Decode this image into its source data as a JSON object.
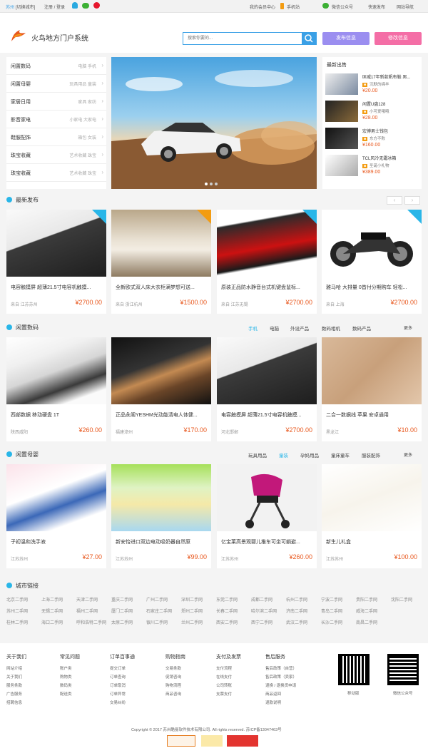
{
  "topbar": {
    "city": "苏州",
    "switch_city": "[切换城市]",
    "login": "注册 / 登录",
    "member": "我的会员中心",
    "mobile": "手机站",
    "wechat": "微信公众号",
    "quick_post": "快速发布",
    "site_nav": "网站导航"
  },
  "header": {
    "logo": "火鸟地方门户系统",
    "search_placeholder": "搜索你要的...",
    "post_btn": "发布信息",
    "edit_btn": "修改信息"
  },
  "colors": {
    "accent": "#29b6e8",
    "price": "#e8581e",
    "post": "#9b8ef0",
    "edit": "#f46ea6"
  },
  "categories": [
    {
      "name": "闲置数码",
      "sub": "电脑  手机"
    },
    {
      "name": "闲置母婴",
      "sub": "玩具用品  童装"
    },
    {
      "name": "家居日用",
      "sub": "家具  家纺"
    },
    {
      "name": "影音家电",
      "sub": "小家电  大家电"
    },
    {
      "name": "鞋服配饰",
      "sub": "箱包  女装"
    },
    {
      "name": "珠宝收藏",
      "sub": "艺术收藏  珠宝"
    },
    {
      "name": "珠宝收藏",
      "sub": "艺术收藏  珠宝"
    }
  ],
  "hot": {
    "title": "最新出售",
    "items": [
      {
        "title": "匡威17年新款帆布鞋 男...",
        "user": "沉默的绵羊",
        "price": "¥20.00"
      },
      {
        "title": "闲置U盘128",
        "user": "小可爱哦哦",
        "price": "¥28.00"
      },
      {
        "title": "宏博男士钱包",
        "user": "东方不败",
        "price": "¥160.00"
      },
      {
        "title": "TCL风冷无霜冰箱",
        "user": "圣诞小礼物",
        "price": "¥389.00"
      }
    ]
  },
  "latest": {
    "title": "最新发布",
    "items": [
      {
        "title": "电容触摸屏 超薄21.5寸电容机触摸...",
        "loc": "来自  江苏苏州",
        "price": "¥2700.00"
      },
      {
        "title": "全新欧式双人床大衣柜满梦想可送...",
        "loc": "来自  浙江杭州",
        "price": "¥1500.00"
      },
      {
        "title": "原装正品防水静音台式机键盘鼠标...",
        "loc": "来自  江苏无锡",
        "price": "¥2700.00"
      },
      {
        "title": "雅马哈 大排量 0首付分期购车 轻松...",
        "loc": "来自  上海",
        "price": "¥2700.00"
      }
    ]
  },
  "digital": {
    "title": "闲置数码",
    "tabs": [
      "手机",
      "电脑",
      "外设产品",
      "数码相机",
      "数码产品"
    ],
    "more": "更多",
    "items": [
      {
        "title": "西部数据  移动硬盘 1T",
        "loc": "陕西咸阳",
        "price": "¥260.00"
      },
      {
        "title": "正品永阁YESHM光动能清电人体健...",
        "loc": "福建漳州",
        "price": "¥170.00"
      },
      {
        "title": "电容触摸屏 超薄21.5寸电容机触摸...",
        "loc": "河北邯郸",
        "price": "¥2700.00"
      },
      {
        "title": "二合一数据线 苹果 安卓通用",
        "loc": "黑龙江",
        "price": "¥10.00"
      }
    ]
  },
  "baby": {
    "title": "闲置母婴",
    "tabs": [
      "玩具用品",
      "童装",
      "孕妈用品",
      "童床童车",
      "服装配饰"
    ],
    "more": "更多",
    "items": [
      {
        "title": "子初温和洗手液",
        "loc": "江苏苏州",
        "price": "¥27.00"
      },
      {
        "title": "新安怡进口双边电动吸奶器自然原",
        "loc": "江苏苏州",
        "price": "¥99.00"
      },
      {
        "title": "亿宝莱高景观婴儿推车可坐可躺避...",
        "loc": "江苏苏州",
        "price": "¥260.00"
      },
      {
        "title": "新生儿礼盒",
        "loc": "江苏苏州",
        "price": "¥100.00"
      }
    ]
  },
  "links": {
    "title": "城市链接",
    "rows": [
      [
        "北京二手网",
        "上海二手网",
        "天津二手网",
        "重庆二手网",
        "广州二手网",
        "深圳二手网",
        "东莞二手网",
        "成都二手网",
        "杭州二手网",
        "宁波二手网",
        "贵阳二手网",
        "沈阳二手网"
      ],
      [
        "苏州二手网",
        "无锡二手网",
        "福州二手网",
        "厦门二手网",
        "石家庄二手网",
        "郑州二手网",
        "长春二手网",
        "哈尔滨二手网",
        "济南二手网",
        "青岛二手网",
        "威海二手网"
      ],
      [
        "桂林二手网",
        "海口二手网",
        "呼和浩特二手网",
        "太原二手网",
        "银川二手网",
        "兰州二手网",
        "西安二手网",
        "西宁二手网",
        "武汉二手网",
        "长沙二手网",
        "南昌二手网"
      ]
    ]
  },
  "footer": {
    "cols": [
      {
        "h": "关于我们",
        "l": [
          "网站介绍",
          "关于我们",
          "服务条款",
          "广告服务",
          "招聘信息"
        ]
      },
      {
        "h": "常见问题",
        "l": [
          "账户类",
          "购物类",
          "数码类",
          "配送类"
        ]
      },
      {
        "h": "订单百事通",
        "l": [
          "提交订单",
          "订单查询",
          "订单取消",
          "订单异常",
          "交易纠纷"
        ]
      },
      {
        "h": "购物指南",
        "l": [
          "交易条款",
          "促销咨询",
          "购物流程",
          "商品咨询"
        ]
      },
      {
        "h": "支付及发票",
        "l": [
          "支付流程",
          "在线支付",
          "公司转账",
          "支票支付"
        ]
      },
      {
        "h": "售后服务",
        "l": [
          "售后政策（自营）",
          "售后政策（卖家）",
          "退换 / 退换货申请",
          "商品返回",
          "退款说明"
        ]
      }
    ],
    "qr1": "移动版",
    "qr2": "微信公众号",
    "copyright": "Copyright © 2017 苏州酷曼软件技术有限公司. All rights reserved.   苏ICP备13047463号"
  }
}
